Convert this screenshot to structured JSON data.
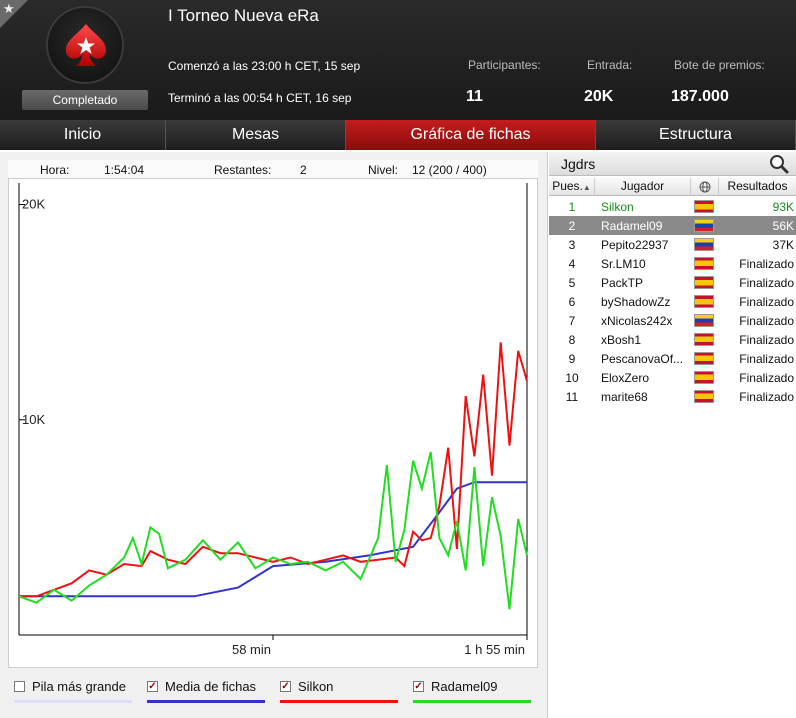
{
  "header": {
    "title": "I Torneo Nueva eRa",
    "status": "Completado",
    "started": "Comenzó a las 23:00 h CET, 15 sep",
    "ended": "Terminó a las 00:54 h CET, 16 sep",
    "stats": {
      "participants_label": "Participantes:",
      "participants_value": "11",
      "entry_label": "Entrada:",
      "entry_value": "20K",
      "prize_label": "Bote de premios:",
      "prize_value": "187.000"
    }
  },
  "tabs": [
    {
      "label": "Inicio",
      "active": false
    },
    {
      "label": "Mesas",
      "active": false
    },
    {
      "label": "Gráfica de fichas",
      "active": true
    },
    {
      "label": "Estructura",
      "active": false
    }
  ],
  "chart_panel": {
    "hora_label": "Hora:",
    "hora_value": "1:54:04",
    "restantes_label": "Restantes:",
    "restantes_value": "2",
    "nivel_label": "Nivel:",
    "nivel_value": "12 (200 / 400)"
  },
  "chart_data": {
    "type": "line",
    "y_ticks": [
      "20K",
      "10K"
    ],
    "x_ticks": [
      "58 min",
      "1 h 55 min"
    ],
    "ylim": [
      0,
      21000
    ],
    "xlim": [
      0,
      116
    ],
    "series": [
      {
        "name": "Media de fichas",
        "color": "#3333cc",
        "x": [
          0,
          20,
          40,
          50,
          58,
          70,
          80,
          90,
          96,
          100,
          104,
          108,
          112,
          116
        ],
        "y": [
          1800,
          1800,
          1800,
          2200,
          3200,
          3400,
          3700,
          4100,
          5700,
          6800,
          7100,
          7100,
          7100,
          7100
        ]
      },
      {
        "name": "Silkon",
        "color": "#ee1111",
        "x": [
          0,
          4,
          8,
          12,
          16,
          20,
          24,
          28,
          30,
          34,
          38,
          42,
          46,
          50,
          54,
          58,
          62,
          66,
          70,
          74,
          78,
          82,
          86,
          88,
          90,
          92,
          94,
          96,
          98,
          100,
          102,
          104,
          106,
          108,
          110,
          112,
          114,
          116
        ],
        "y": [
          1800,
          1800,
          2100,
          2400,
          3000,
          2800,
          3300,
          3200,
          3900,
          3500,
          3300,
          4100,
          3800,
          3800,
          3600,
          3400,
          3600,
          3300,
          3500,
          3700,
          3400,
          3500,
          3600,
          3200,
          4800,
          4400,
          4500,
          6000,
          8700,
          4000,
          11100,
          8300,
          12100,
          7400,
          13600,
          8800,
          13200,
          11800
        ]
      },
      {
        "name": "Radamel09",
        "color": "#22dd22",
        "x": [
          0,
          4,
          8,
          12,
          16,
          20,
          24,
          26,
          28,
          30,
          32,
          34,
          38,
          42,
          46,
          50,
          54,
          58,
          62,
          66,
          70,
          74,
          78,
          82,
          84,
          86,
          88,
          90,
          92,
          94,
          96,
          98,
          100,
          102,
          104,
          106,
          108,
          110,
          112,
          114,
          116
        ],
        "y": [
          1800,
          1500,
          2100,
          1600,
          2300,
          2800,
          3600,
          4500,
          3300,
          5000,
          4700,
          3100,
          3500,
          4400,
          3500,
          4300,
          3100,
          3600,
          3300,
          3400,
          3000,
          3400,
          2600,
          4500,
          7900,
          3400,
          4900,
          8100,
          6800,
          8500,
          4500,
          3700,
          5300,
          3000,
          7800,
          3200,
          6400,
          4600,
          1200,
          5400,
          3700
        ]
      }
    ],
    "grid": false,
    "legend_position": "bottom"
  },
  "legend": [
    {
      "label": "Pila más grande",
      "checked": false,
      "color": "#ddddf8"
    },
    {
      "label": "Media de fichas",
      "checked": true,
      "color": "#3333cc"
    },
    {
      "label": "Silkon",
      "checked": true,
      "color": "#ee1111"
    },
    {
      "label": "Radamel09",
      "checked": true,
      "color": "#22dd22"
    }
  ],
  "players": {
    "title": "Jgdrs",
    "col_pos": "Pues.",
    "col_player": "Jugador",
    "col_results": "Resultados",
    "rows": [
      {
        "pos": "1",
        "name": "Silkon",
        "flag": "es",
        "result": "93K"
      },
      {
        "pos": "2",
        "name": "Radamel09",
        "flag": "ve",
        "result": "56K"
      },
      {
        "pos": "3",
        "name": "Pepito22937",
        "flag": "ve",
        "result": "37K"
      },
      {
        "pos": "4",
        "name": "Sr.LM10",
        "flag": "es",
        "result": "Finalizado"
      },
      {
        "pos": "5",
        "name": "PackTP",
        "flag": "es",
        "result": "Finalizado"
      },
      {
        "pos": "6",
        "name": "byShadowZz",
        "flag": "es",
        "result": "Finalizado"
      },
      {
        "pos": "7",
        "name": "xNicolas242x",
        "flag": "ve",
        "result": "Finalizado"
      },
      {
        "pos": "8",
        "name": "xBosh1",
        "flag": "es",
        "result": "Finalizado"
      },
      {
        "pos": "9",
        "name": "PescanovaOf...",
        "flag": "es",
        "result": "Finalizado"
      },
      {
        "pos": "10",
        "name": "EloxZero",
        "flag": "es",
        "result": "Finalizado"
      },
      {
        "pos": "11",
        "name": "marite68",
        "flag": "es",
        "result": "Finalizado"
      }
    ]
  }
}
